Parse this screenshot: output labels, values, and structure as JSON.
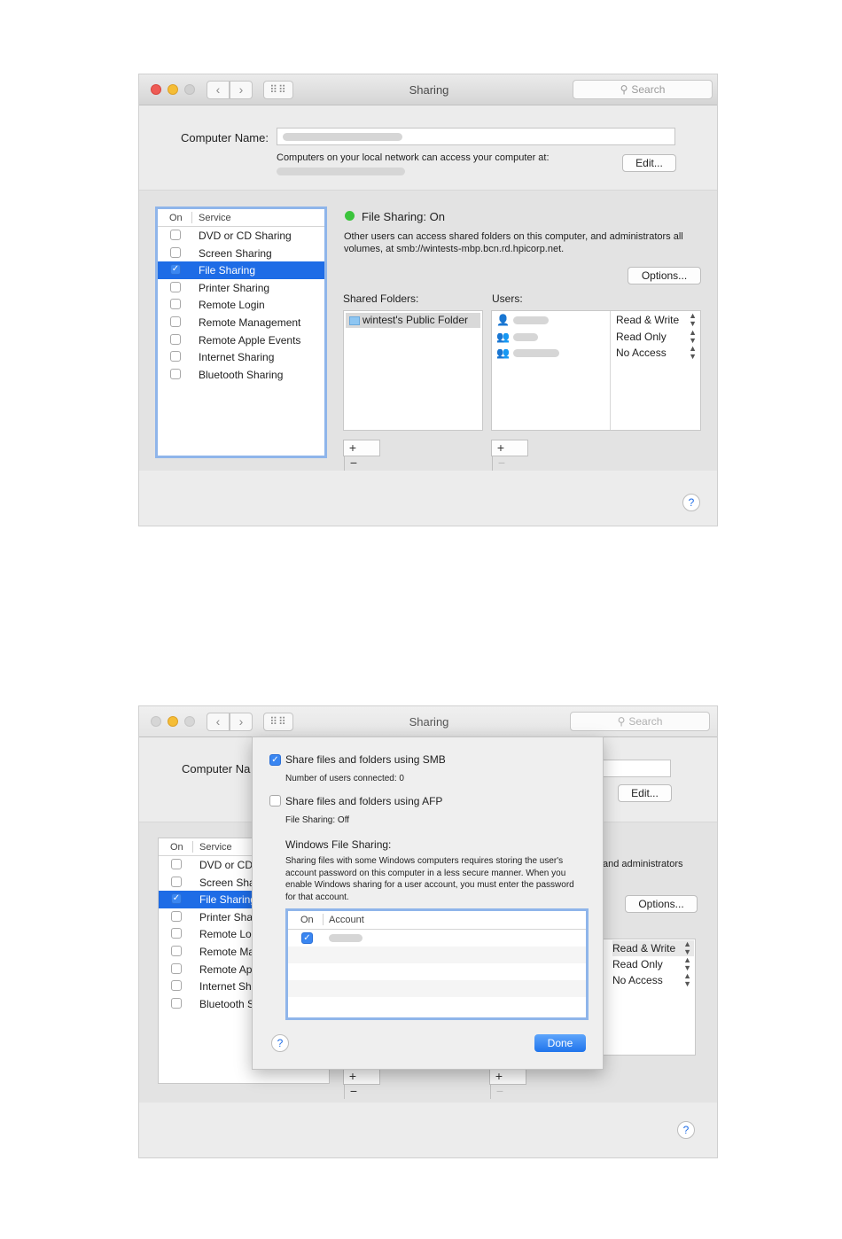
{
  "window1": {
    "title": "Sharing",
    "search_placeholder": "Search",
    "computer_name_label": "Computer Name:",
    "access_text": "Computers on your local network can access your computer at:",
    "edit_button": "Edit...",
    "service_header_on": "On",
    "service_header_service": "Service",
    "services": [
      {
        "label": "DVD or CD Sharing",
        "on": false
      },
      {
        "label": "Screen Sharing",
        "on": false
      },
      {
        "label": "File Sharing",
        "on": true,
        "selected": true
      },
      {
        "label": "Printer Sharing",
        "on": false
      },
      {
        "label": "Remote Login",
        "on": false
      },
      {
        "label": "Remote Management",
        "on": false
      },
      {
        "label": "Remote Apple Events",
        "on": false
      },
      {
        "label": "Internet Sharing",
        "on": false
      },
      {
        "label": "Bluetooth Sharing",
        "on": false
      }
    ],
    "status_title": "File Sharing: On",
    "status_desc": "Other users can access shared folders on this computer, and administrators all volumes, at smb://wintests-mbp.bcn.rd.hpicorp.net.",
    "options_button": "Options...",
    "shared_folders_label": "Shared Folders:",
    "users_label": "Users:",
    "shared_folder_item": "wintest's Public Folder",
    "permissions": [
      "Read & Write",
      "Read Only",
      "No Access"
    ],
    "help": "?"
  },
  "window2": {
    "title": "Sharing",
    "search_placeholder": "Search",
    "computer_name_partial": "Computer Na",
    "edit_button": "Edit...",
    "service_header_on": "On",
    "service_header_service": "Service",
    "services_partial": [
      {
        "label": "DVD or CD",
        "on": false
      },
      {
        "label": "Screen Sha",
        "on": false
      },
      {
        "label": "File Sharing",
        "on": true,
        "selected": true
      },
      {
        "label": "Printer Sha",
        "on": false
      },
      {
        "label": "Remote Log",
        "on": false
      },
      {
        "label": "Remote Ma",
        "on": false
      },
      {
        "label": "Remote Ap",
        "on": false
      },
      {
        "label": "Internet Sh",
        "on": false
      },
      {
        "label": "Bluetooth S",
        "on": false
      }
    ],
    "desc_partial": "and administrators",
    "options_button": "Options...",
    "permissions": [
      "Read & Write",
      "Read Only",
      "No Access"
    ],
    "help": "?"
  },
  "sheet": {
    "smb_label": "Share files and folders using SMB",
    "smb_on": true,
    "smb_users": "Number of users connected: 0",
    "afp_label": "Share files and folders using AFP",
    "afp_on": false,
    "afp_status": "File Sharing: Off",
    "windows_title": "Windows File Sharing:",
    "windows_desc": "Sharing files with some Windows computers requires storing the user's account password on this computer in a less secure manner.  When you enable Windows sharing for a user account, you must enter the password for that account.",
    "header_on": "On",
    "header_account": "Account",
    "done_button": "Done",
    "help": "?"
  }
}
